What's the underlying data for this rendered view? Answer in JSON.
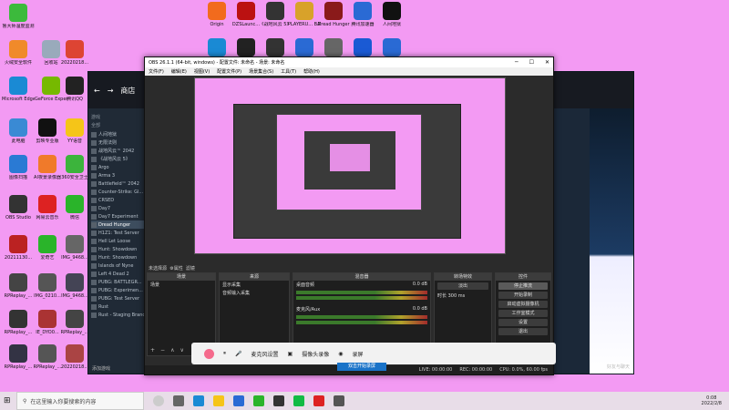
{
  "desktop_icons": [
    {
      "label": "鲁大师温度监测",
      "color": "#3cba3c"
    },
    {
      "label": "火绒安全软件",
      "color": "#f08a2a"
    },
    {
      "label": "回收站",
      "color": "#9ab"
    },
    {
      "label": "20220218...",
      "color": "#d43"
    },
    {
      "label": "Microsoft Edge",
      "color": "#1a8ad4"
    },
    {
      "label": "GeForce Experience",
      "color": "#76b900"
    },
    {
      "label": "腾讯QQ",
      "color": "#222"
    },
    {
      "label": "此电脑",
      "color": "#3a8ad4"
    },
    {
      "label": "剪映专业版",
      "color": "#111"
    },
    {
      "label": "YY语音",
      "color": "#f5c518"
    },
    {
      "label": "图像扫描",
      "color": "#2a7ad4"
    },
    {
      "label": "AI夜景录像器",
      "color": "#f07a2a"
    },
    {
      "label": "360安全卫士",
      "color": "#3cb43c"
    },
    {
      "label": "OBS Studio",
      "color": "#333"
    },
    {
      "label": "网易云音乐",
      "color": "#d22"
    },
    {
      "label": "微信",
      "color": "#2ab42a"
    },
    {
      "label": "20211130...",
      "color": "#b22"
    },
    {
      "label": "爱奇艺",
      "color": "#2ab42a"
    },
    {
      "label": "IMG_9468...",
      "color": "#666"
    },
    {
      "label": "RPReplay_...",
      "color": "#444"
    },
    {
      "label": "IMG_0210...",
      "color": "#555"
    },
    {
      "label": "IMG_9468...",
      "color": "#445"
    },
    {
      "label": "RPReplay_...",
      "color": "#333"
    },
    {
      "label": "IE_DYO0...",
      "color": "#a33"
    },
    {
      "label": "RPReplay_...",
      "color": "#444"
    },
    {
      "label": "RPReplay_...",
      "color": "#334"
    },
    {
      "label": "RPReplay_...",
      "color": "#555"
    },
    {
      "label": "20220218...",
      "color": "#a44"
    }
  ],
  "top_icons": [
    {
      "label": "Origin",
      "color": "#f26b1d"
    },
    {
      "label": "DZSLaunc...",
      "color": "#b11"
    },
    {
      "label": "《战地风云 5》",
      "color": "#333"
    },
    {
      "label": "PLAYERU... BATTLEGR...",
      "color": "#d8a22a"
    },
    {
      "label": "Dread Hunger",
      "color": "#8a1a1a"
    },
    {
      "label": "腾讯加速器",
      "color": "#2a6ad4"
    },
    {
      "label": "人间地狱",
      "color": "#111"
    }
  ],
  "steam": {
    "nav": "商店",
    "games_label": "游戏",
    "all_label": "全部",
    "games": [
      "人间地狱",
      "无限法则",
      "战地风云™ 2042",
      "《战地风云 5》",
      "Argo",
      "Arma 3",
      "Battlefield™ 2042",
      "Counter-Strike: Gl...",
      "CRSED",
      "Day7",
      "Day7 Experiment",
      "Dread Hunger",
      "H1Z1: Test Server",
      "Hell Let Loose",
      "Hunt: Showdown",
      "Hunt: Showdown",
      "Islands of Nyne",
      "Left 4 Dead 2",
      "PUBG: BATTLEGR...",
      "PUBG: Experimen...",
      "PUBG: Test Server",
      "Rust",
      "Rust - Staging Branch"
    ],
    "selected": "Dread Hunger",
    "add_game": "添加游戏",
    "download": "下载",
    "friends": "好友与聊天"
  },
  "obs": {
    "title": "OBS 26.1.1 (64-bit, windows) - 配置文件: 未命名 - 场景: 未命名",
    "menu": [
      "文件(F)",
      "编辑(E)",
      "视图(V)",
      "配置文件(P)",
      "场景集合(S)",
      "工具(T)",
      "帮助(H)"
    ],
    "no_source": "未选择源",
    "props": "属性",
    "filters": "滤镜",
    "panels": {
      "scenes": {
        "title": "场景",
        "items": [
          "场景"
        ]
      },
      "sources": {
        "title": "来源",
        "items": [
          "显示采集",
          "音频输入采集"
        ]
      },
      "mixer": {
        "title": "混音器",
        "tracks": [
          {
            "name": "桌面音频",
            "db": "0.0 dB"
          },
          {
            "name": "麦克风/Aux",
            "db": "0.0 dB"
          }
        ]
      },
      "transitions": {
        "title": "转场特效",
        "fade": "淡出",
        "duration_label": "时长",
        "duration": "300 ms"
      },
      "controls": {
        "title": "控件",
        "buttons": [
          "停止推流",
          "开始录制",
          "启动虚拟摄像机",
          "工作室模式",
          "设置",
          "退出"
        ]
      }
    },
    "status": {
      "live": "LIVE: 00:00:00",
      "rec": "REC: 00:00:00",
      "cpu": "CPU: 0.0%, 60.00 fps"
    }
  },
  "recorder": {
    "buttons": [
      "麦克风设置",
      "摄像头录像",
      "录屏"
    ],
    "start": "双击开始录屏"
  },
  "taskbar": {
    "search": "在这里输入你要搜索的内容",
    "time": "0:08",
    "date": "2022/2/8"
  }
}
